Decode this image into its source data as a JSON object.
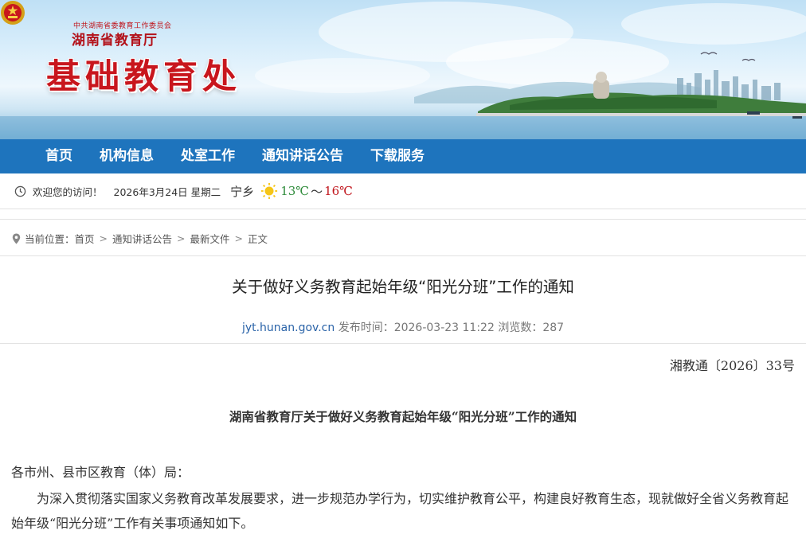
{
  "header": {
    "org_small": "中共湖南省委教育工作委员会",
    "org_name": "湖南省教育厅",
    "site_title": "基础教育处"
  },
  "nav": {
    "items": [
      {
        "label": "首页"
      },
      {
        "label": "机构信息"
      },
      {
        "label": "处室工作"
      },
      {
        "label": "通知讲话公告"
      },
      {
        "label": "下载服务"
      }
    ]
  },
  "infobar": {
    "welcome": "欢迎您的访问！",
    "date": "2026年3月24日 星期二",
    "city": "宁乡",
    "weather_icon": "sun-icon",
    "temp_low": "13℃",
    "temp_sep": "～",
    "temp_high": "16℃"
  },
  "breadcrumb": {
    "prefix": "当前位置：",
    "items": [
      "首页",
      "通知讲话公告",
      "最新文件",
      "正文"
    ]
  },
  "article": {
    "title": "关于做好义务教育起始年级“阳光分班”工作的通知",
    "source": "jyt.hunan.gov.cn",
    "publish_label": "发布时间：",
    "publish_time": "2026-03-23 11:22",
    "views_label": "浏览数：",
    "views": "287",
    "doc_number": "湘教通〔2026〕33号",
    "doc_title": "湖南省教育厅关于做好义务教育起始年级“阳光分班”工作的通知",
    "salutation": "各市州、县市区教育（体）局：",
    "paragraph1": "为深入贯彻落实国家义务教育改革发展要求，进一步规范办学行为，切实维护教育公平，构建良好教育生态，现就做好全省义务教育起始年级“阳光分班”工作有关事项通知如下。"
  },
  "colors": {
    "nav_bg": "#1e74bd",
    "title_red": "#c8161d",
    "temp_low": "#2e8b3a",
    "temp_high": "#c0141b",
    "source_link": "#2a63a8"
  }
}
